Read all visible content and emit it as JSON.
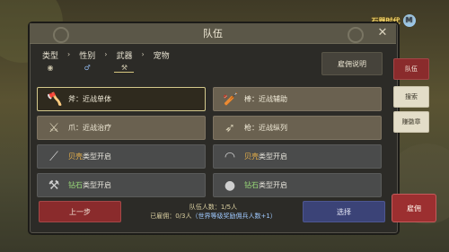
{
  "window": {
    "title": "队伍"
  },
  "logo": {
    "text": "石器时代",
    "badge": "M"
  },
  "steps": [
    {
      "label": "类型",
      "icon": "◉"
    },
    {
      "label": "性别",
      "icon": "♂"
    },
    {
      "label": "武器",
      "icon": "⚒"
    },
    {
      "label": "宠物",
      "icon": ""
    }
  ],
  "help_button": "雇佣说明",
  "cards": [
    {
      "text": "斧：近战单体",
      "icon": "axe-icon"
    },
    {
      "text": "棒：近战辅助",
      "icon": "club-icon"
    },
    {
      "text": "爪：近战治疗",
      "icon": "claw-icon"
    },
    {
      "text": "枪：近战纵列",
      "icon": "spear-icon"
    },
    {
      "prefix": "贝壳",
      "suffix": "类型开启",
      "icon": "shell-weapon-icon"
    },
    {
      "prefix": "贝壳",
      "suffix": "类型开启",
      "icon": "boomerang-icon"
    },
    {
      "prefix": "钻石",
      "suffix": "类型开启",
      "icon": "stone-axe-icon"
    },
    {
      "prefix": "钻石",
      "suffix": "类型开启",
      "icon": "sack-icon"
    }
  ],
  "footer": {
    "back": "上一步",
    "select": "选择",
    "team_count": "队伍人数：1/5人",
    "hired_count": "已雇佣：0/3人",
    "hired_note": "（世界等级奖励佣兵人数+1）"
  },
  "side_tabs": [
    "队伍",
    "搜索",
    "赚徽章"
  ],
  "hire_button": "雇佣",
  "colors": {
    "accent_gold": "#d4c98c",
    "back_red": "#8a2b2c",
    "select_blue": "#3b4377"
  }
}
